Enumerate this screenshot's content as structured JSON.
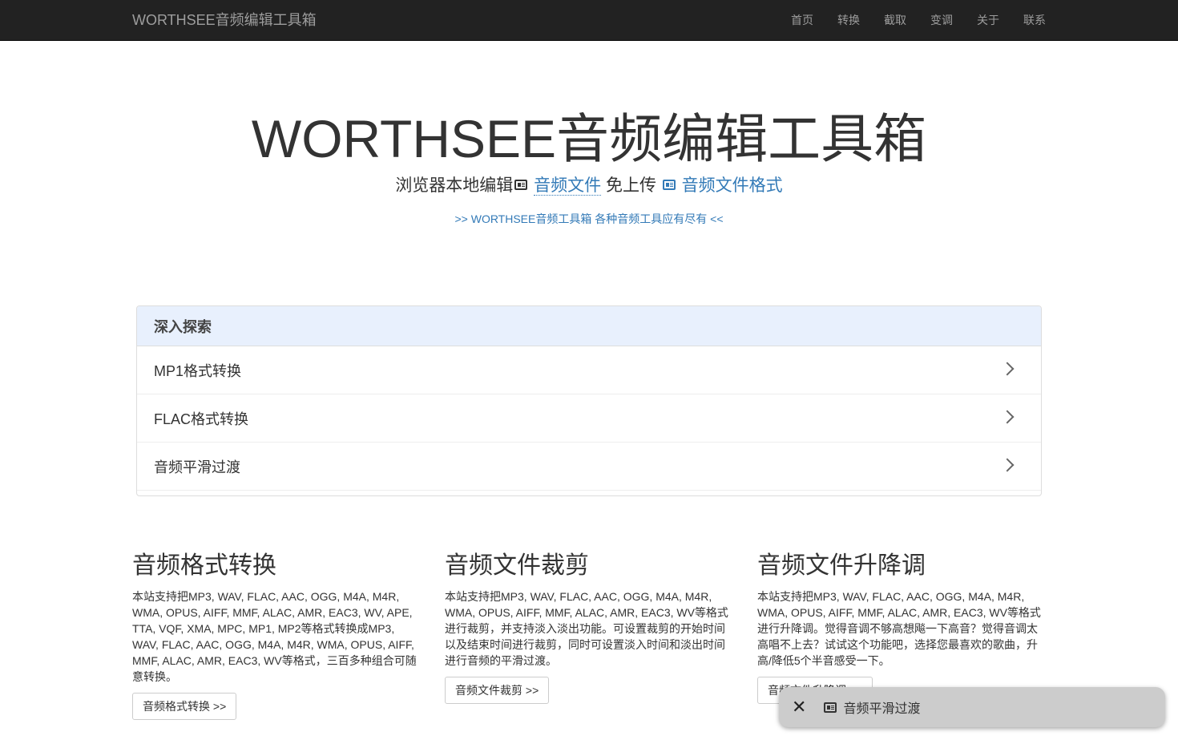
{
  "navbar": {
    "brand": "WORTHSEE音频编辑工具箱",
    "links": [
      "首页",
      "转换",
      "截取",
      "变调",
      "关于",
      "联系"
    ]
  },
  "hero": {
    "title": "WORTHSEE音频编辑工具箱",
    "sub_prefix": "浏览器本地编辑",
    "sub_link1": "音频文件",
    "sub_middle": " 免上传 ",
    "sub_link2": "音频文件格式",
    "promo": ">> WORTHSEE音频工具箱 各种音频工具应有尽有 <<"
  },
  "explore": {
    "title": "深入探索",
    "items": [
      "MP1格式转换",
      "FLAC格式转换",
      "音频平滑过渡"
    ]
  },
  "features": [
    {
      "title": "音频格式转换",
      "text": "本站支持把MP3, WAV, FLAC, AAC, OGG, M4A, M4R, WMA, OPUS, AIFF, MMF, ALAC, AMR, EAC3, WV, APE, TTA, VQF, XMA, MPC, MP1, MP2等格式转换成MP3, WAV, FLAC, AAC, OGG, M4A, M4R, WMA, OPUS, AIFF, MMF, ALAC, AMR, EAC3, WV等格式，三百多种组合可随意转换。",
      "button": "音频格式转换 >>"
    },
    {
      "title": "音频文件裁剪",
      "text": "本站支持把MP3, WAV, FLAC, AAC, OGG, M4A, M4R, WMA, OPUS, AIFF, MMF, ALAC, AMR, EAC3, WV等格式进行裁剪，并支持淡入淡出功能。可设置裁剪的开始时间以及结束时间进行裁剪，同时可设置淡入时间和淡出时间进行音频的平滑过渡。",
      "button": "音频文件裁剪 >>"
    },
    {
      "title": "音频文件升降调",
      "text": "本站支持把MP3, WAV, FLAC, AAC, OGG, M4A, M4R, WMA, OPUS, AIFF, MMF, ALAC, AMR, EAC3, WV等格式进行升降调。觉得音调不够高想飚一下高音？觉得音调太高唱不上去？试试这个功能吧，选择您最喜欢的歌曲，升高/降低5个半音感受一下。",
      "button": "音频文件升降调 >>"
    }
  ],
  "toast": {
    "close": "✕",
    "label": "音频平滑过渡"
  }
}
